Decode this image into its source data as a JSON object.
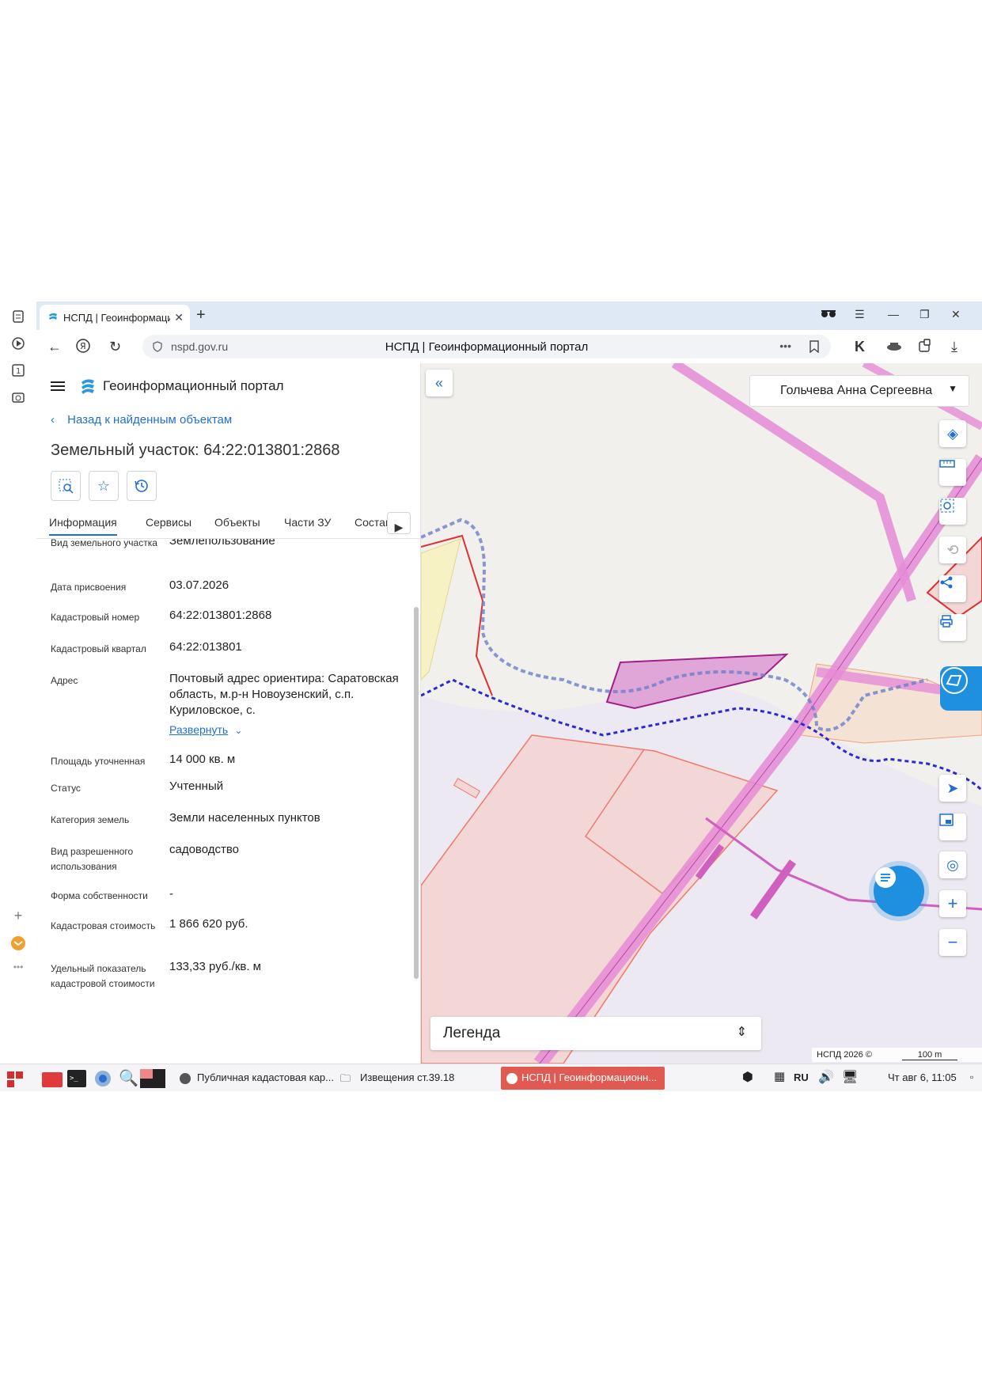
{
  "browser": {
    "tab_title": "НСПД | Геоинформаци",
    "tab_close": "✕",
    "new_tab": "+",
    "url_host": "nspd.gov.ru",
    "page_title": "НСПД | Геоинформационный портал"
  },
  "portal": {
    "title": "Геоинформационный портал",
    "back_label": "Назад к найденным объектам",
    "object_title": "Земельный участок: 64:22:013801:2868"
  },
  "tabs": [
    "Информация",
    "Сервисы",
    "Объекты",
    "Части ЗУ",
    "Состав"
  ],
  "info": {
    "r0": {
      "label": "Вид земельного участка",
      "value": "Землепользование"
    },
    "r1": {
      "label": "Дата присвоения",
      "value": "03.07.2026"
    },
    "r2": {
      "label": "Кадастровый номер",
      "value": "64:22:013801:2868"
    },
    "r3": {
      "label": "Кадастровый квартал",
      "value": "64:22:013801"
    },
    "r4": {
      "label": "Адрес",
      "value": "Почтовый адрес ориентира: Саратовская область, м.р-н Новоузенский, с.п. Куриловское, с.",
      "expand": "Развернуть"
    },
    "r5": {
      "label": "Площадь уточненная",
      "value": "14 000 кв. м"
    },
    "r6": {
      "label": "Статус",
      "value": "Учтенный"
    },
    "r7": {
      "label": "Категория земель",
      "value": "Земли населенных пунктов"
    },
    "r8": {
      "label": "Вид разрешенного использования",
      "value": "садоводство"
    },
    "r9": {
      "label": "Форма собственности",
      "value": "-"
    },
    "r10": {
      "label": "Кадастровая стоимость",
      "value": "1 866 620 руб."
    },
    "r11": {
      "label": "Удельный показатель кадастровой стоимости",
      "value": "133,33 руб./кв. м"
    }
  },
  "map": {
    "user_name": "Гольчева Анна Сергеевна",
    "legend_label": "Легенда",
    "copyright": "НСПД 2026 ©",
    "scale": "100 m"
  },
  "taskbar": {
    "item1": "Публичная кадастовая кар...",
    "item2": "Извещения ст.39.18",
    "item3": "НСПД | Геоинформационн...",
    "lang": "RU",
    "clock": "Чт авг  6, 11:05"
  },
  "colors": {
    "accent": "#1f6fd6",
    "parcel_pink": "#e58bd6",
    "boundary_red": "#e03030",
    "active_task": "#e05a52"
  }
}
